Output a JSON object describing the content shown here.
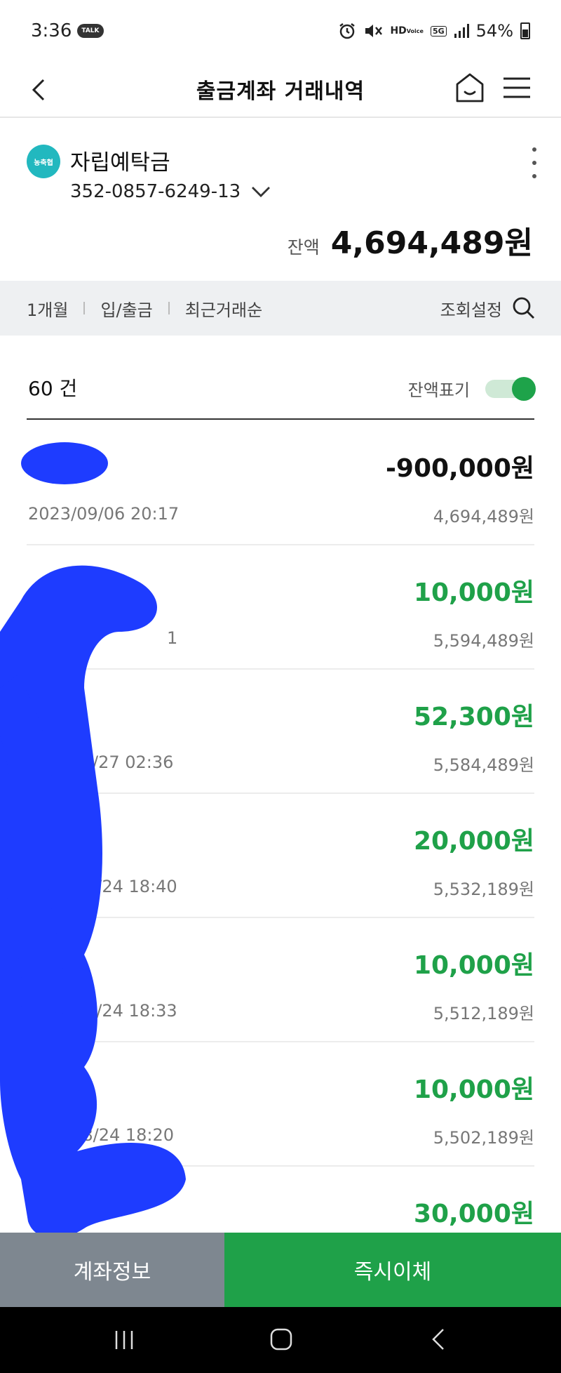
{
  "status_bar": {
    "time": "3:36",
    "talk_badge": "TALK",
    "hd_top": "HD",
    "hd_bottom": "Voice",
    "network": "5G",
    "battery": "54%"
  },
  "header": {
    "title": "출금계좌 거래내역",
    "icons": [
      "back-icon",
      "home-icon",
      "menu-icon"
    ]
  },
  "account": {
    "bank_logo_text": "농축협",
    "name": "자립예탁금",
    "number": "352-0857-6249-13",
    "balance_label": "잔액",
    "balance_value": "4,694,489원"
  },
  "filters": {
    "period": "1개월",
    "type": "입/출금",
    "order": "최근거래순",
    "settings_label": "조회설정"
  },
  "summary": {
    "count": "60 건",
    "balance_toggle_label": "잔액표기",
    "balance_toggle_on": true
  },
  "transactions": [
    {
      "amount": "-900,000원",
      "kind": "debit",
      "datetime": "2023/09/06  20:17",
      "balance": "4,694,489원"
    },
    {
      "amount": "10,000원",
      "kind": "credit",
      "datetime": "1",
      "balance": "5,594,489원"
    },
    {
      "amount": "52,300원",
      "kind": "credit",
      "datetime": "/27  02:36",
      "balance": "5,584,489원"
    },
    {
      "amount": "20,000원",
      "kind": "credit",
      "datetime": "8/24  18:40",
      "balance": "5,532,189원"
    },
    {
      "amount": "10,000원",
      "kind": "credit",
      "datetime": "8/24  18:33",
      "balance": "5,512,189원"
    },
    {
      "amount": "10,000원",
      "kind": "credit",
      "datetime": "/08/24  18:20",
      "balance": "5,502,189원"
    },
    {
      "amount": "30,000원",
      "kind": "credit",
      "datetime": "",
      "balance": ""
    }
  ],
  "bottom_buttons": {
    "account_info": "계좌정보",
    "instant_transfer": "즉시이체"
  },
  "colors": {
    "credit_green": "#1fa149",
    "debit_black": "#111111",
    "redaction_blue": "#1e3cff",
    "logo_teal": "#22b8bf",
    "info_button_gray": "#7e8790"
  }
}
